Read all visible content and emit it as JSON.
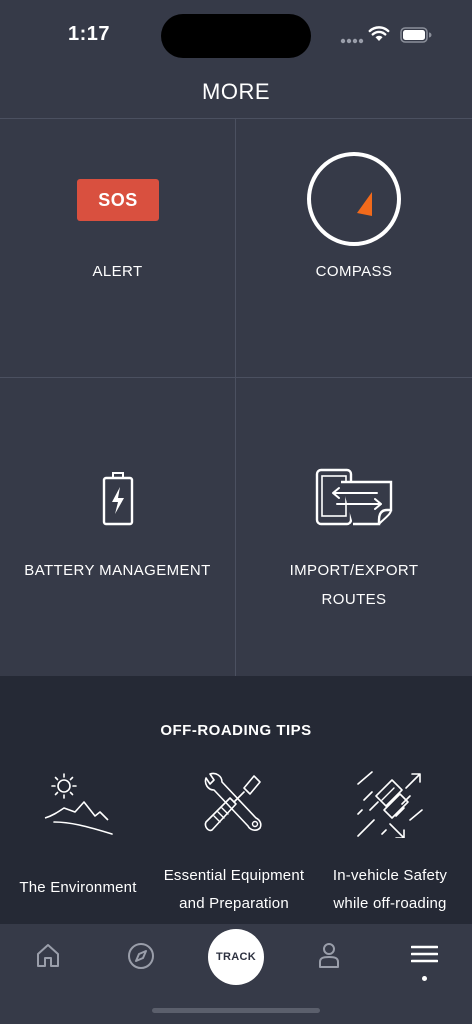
{
  "status_bar": {
    "time": "1:17"
  },
  "header": {
    "title": "MORE"
  },
  "tiles": [
    {
      "label": "ALERT",
      "badge": "SOS",
      "icon": "sos-badge"
    },
    {
      "label": "COMPASS",
      "icon": "compass-icon"
    },
    {
      "label": "BATTERY MANAGEMENT",
      "icon": "battery-charging-icon"
    },
    {
      "label_line1": "IMPORT/EXPORT",
      "label_line2": "ROUTES",
      "icon": "import-export-icon"
    }
  ],
  "tips": {
    "title": "OFF-ROADING TIPS",
    "items": [
      {
        "label_line1": "The Environment",
        "icon": "landscape-icon"
      },
      {
        "label_line1": "Essential Equipment",
        "label_line2": "and Preparation",
        "icon": "tools-icon"
      },
      {
        "label_line1": "In-vehicle Safety",
        "label_line2": "while off-roading",
        "icon": "seatbelt-icon"
      }
    ]
  },
  "tabbar": {
    "items": [
      {
        "icon": "home-icon"
      },
      {
        "icon": "compass-nav-icon"
      },
      {
        "label": "TRACK"
      },
      {
        "icon": "profile-icon"
      },
      {
        "icon": "menu-icon",
        "active": true
      }
    ]
  },
  "colors": {
    "background": "#363a48",
    "tips_background": "#252935",
    "sos": "#d9503f",
    "compass_needle": "#f26a1b"
  }
}
